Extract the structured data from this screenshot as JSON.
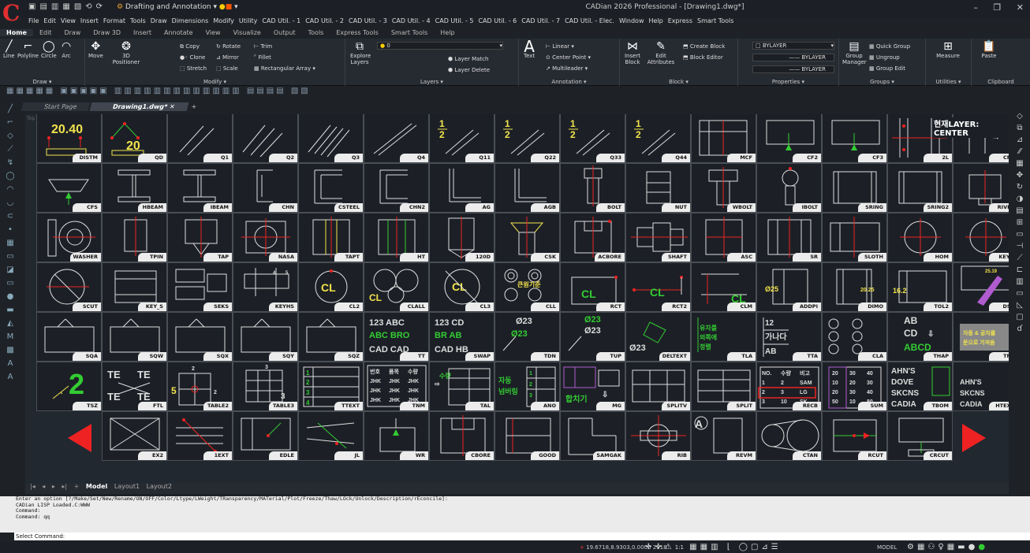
{
  "titlebar": {
    "workspace": "Drafting and Annotation",
    "title": "CADian 2026 Professional - [Drawing1.dwg*]",
    "controls": [
      "–",
      "❐",
      "✕"
    ]
  },
  "menus": [
    "File",
    "Edit",
    "View",
    "Insert",
    "Format",
    "Tools",
    "Draw",
    "Dimensions",
    "Modify",
    "Utility",
    "CAD Util. - 1",
    "CAD Util. - 2",
    "CAD Util. - 3",
    "CAD Util. - 4",
    "CAD Util. - 5",
    "CAD Util. - 6",
    "CAD Util. - 7",
    "CAD Util. - Elec.",
    "Window",
    "Help",
    "Express",
    "Smart Tools"
  ],
  "ribbon_tabs": [
    "Home",
    "Edit",
    "Draw",
    "Draw 3D",
    "Insert",
    "Annotate",
    "View",
    "Visualize",
    "Output",
    "Tools",
    "Express Tools",
    "Smart Tools",
    "Help"
  ],
  "ribbon": {
    "draw": {
      "label": "Draw",
      "items": [
        "Line",
        "Polyline",
        "Circle",
        "Arc"
      ]
    },
    "modify": {
      "label": "Modify",
      "move": "Move",
      "positioner": "3D Positioner",
      "copy": "Copy",
      "rotate": "Rotate",
      "trim": "Trim",
      "clone": "Clone",
      "mirror": "Mirror",
      "fillet": "Fillet",
      "stretch": "Stretch",
      "scale": "Scale",
      "rect_array": "Rectangular Array"
    },
    "layers": {
      "label": "Layers",
      "explore": "Explore Layers",
      "layer_value": "0",
      "match": "Layer Match",
      "delete": "Layer Delete"
    },
    "annotation": {
      "label": "Annotation",
      "text": "Text",
      "linear": "Linear",
      "center_point": "Center Point",
      "multileader": "Multileader"
    },
    "block": {
      "label": "Block",
      "insert": "Insert Block",
      "edit": "Edit Attributes",
      "create": "Create Block",
      "editor": "Block Editor"
    },
    "properties": {
      "label": "Properties",
      "color": "BYLAYER",
      "linetype": "BYLAYER",
      "lineweight": "BYLAYER"
    },
    "groups": {
      "label": "Groups",
      "manager": "Group Manager",
      "quick": "Quick Group",
      "ungroup": "Ungroup",
      "edit": "Group Edit"
    },
    "utilities": {
      "label": "Utilities",
      "measure": "Measure"
    },
    "clipboard": {
      "label": "Clipboard",
      "paste": "Paste"
    }
  },
  "doc_tabs": [
    "Start Page",
    "Drawing1.dwg*"
  ],
  "canvas": {
    "corner": "Top",
    "layer_label": "현재LAYER: CENTER"
  },
  "grid": [
    [
      "DISTM",
      "QD",
      "Q1",
      "Q2",
      "Q3",
      "Q4",
      "Q11",
      "Q22",
      "Q33",
      "Q44",
      "MCF",
      "CF2",
      "CF3",
      "2L",
      "CFC"
    ],
    [
      "CFS",
      "HBEAM",
      "IBEAM",
      "CHN",
      "CSTEEL",
      "CHN2",
      "AG",
      "AGB",
      "BOLT",
      "NUT",
      "WBOLT",
      "IBOLT",
      "SRING",
      "SRING2",
      "RIVET"
    ],
    [
      "WASHER",
      "TPIN",
      "TAP",
      "NASA",
      "TAPT",
      "HT",
      "120D",
      "CSK",
      "ACBORE",
      "SHAFT",
      "ASC",
      "SR",
      "SLOTH",
      "HOM",
      "KEYH"
    ],
    [
      "SCUT",
      "KEY_S",
      "SEKS",
      "KEYHS",
      "CL2",
      "CLALL",
      "CL3",
      "CLL",
      "RCT",
      "RCT2",
      "CLM",
      "ADDPI",
      "DIMO",
      "TOL2",
      "DSS"
    ],
    [
      "SQA",
      "SQW",
      "SQX",
      "SQY",
      "SQZ",
      "TT",
      "SWAP",
      "TDN",
      "TUP",
      "DELTEXT",
      "TLA",
      "TTA",
      "CLA",
      "THAP",
      "TFR"
    ],
    [
      "TSZ",
      "FTL",
      "TABLE2",
      "TABLE3",
      "TTEXT",
      "TNM",
      "TAL",
      "ANO",
      "MG",
      "SPLITV",
      "SPLIT",
      "RECB",
      "SUM",
      "TBOM",
      "HTEXT"
    ],
    [
      "",
      "EX2",
      "1EXT",
      "EDLE",
      "JL",
      "WR",
      "CBORE",
      "GOOD",
      "SAMGAK",
      "RIB",
      "REVM",
      "CTAN",
      "RCUT",
      "CRCUT",
      ""
    ]
  ],
  "cell_text": {
    "distm": "20.40",
    "qd": "20",
    "q11": "1\n2",
    "cl": "CL",
    "kor_center": "큰원기준",
    "tt": [
      "123 ABC",
      "ABC BRO",
      "CAD CAD"
    ],
    "swap": [
      "123 CD",
      "BR AB",
      "CAD HB"
    ],
    "tdn": [
      "Ø23",
      "Ø23"
    ],
    "tup": [
      "Ø23",
      "Ø23"
    ],
    "deltext": "Ø23",
    "tla": [
      "유자를",
      "외쪽에",
      "정렬"
    ],
    "tta": [
      "12",
      "가나다",
      "AB"
    ],
    "thap": [
      "AB",
      "CD",
      "ABCD"
    ],
    "tfr": [
      "자동 & 공자를",
      "문으로 가져옴"
    ],
    "tsz": "2",
    "ftl": [
      "TE",
      "TE",
      "TE",
      "TE"
    ],
    "tnm": [
      [
        "번호",
        "품목",
        "수량"
      ],
      [
        "JHK",
        "JHK",
        "JHK"
      ],
      [
        "JHK",
        "JHK",
        "JHK"
      ],
      [
        "JHK",
        "JHK",
        "JHK"
      ]
    ],
    "tal": "수량",
    "ano": [
      "자동",
      "넘버링"
    ],
    "mg": "합치기",
    "recb": [
      [
        "NO.",
        "수량",
        "비고"
      ],
      [
        "1",
        "2",
        "SAM"
      ],
      [
        "2",
        "3",
        "LG"
      ],
      [
        "3",
        "10",
        "SK"
      ]
    ],
    "sum": [
      [
        "20",
        "30",
        "40"
      ],
      [
        "10",
        "20",
        "30"
      ],
      [
        "20",
        "30",
        "40"
      ],
      [
        "50",
        "10",
        "80"
      ]
    ],
    "tbom": [
      "AHN'S",
      "DOVE",
      "SKCNS",
      "CADIA"
    ],
    "htext": [
      "AHN'S",
      "SKCNS",
      "CADIA"
    ],
    "addpi": "Ø25",
    "dimo": "20.25",
    "tol2": "16.2",
    "dss": "25.19"
  },
  "layout_tabs": [
    "Model",
    "Layout1",
    "Layout2"
  ],
  "command": {
    "history": [
      "Enter an option [?/Make/Set/New/Rename/ON/OFF/Color/Ltype/LWeight/TRansparency/MATerial/Plot/Freeze/Thaw/LOck/Unlock/Description/rEconcile]:",
      "CADian LISP Loaded.C:WWW",
      "Command:",
      "Command: qq"
    ],
    "prompt": "Select Command:"
  },
  "status": {
    "coords": "19.6718,8.9303,0.0000",
    "year": "2018",
    "scale": "1:1",
    "model": "MODEL"
  }
}
